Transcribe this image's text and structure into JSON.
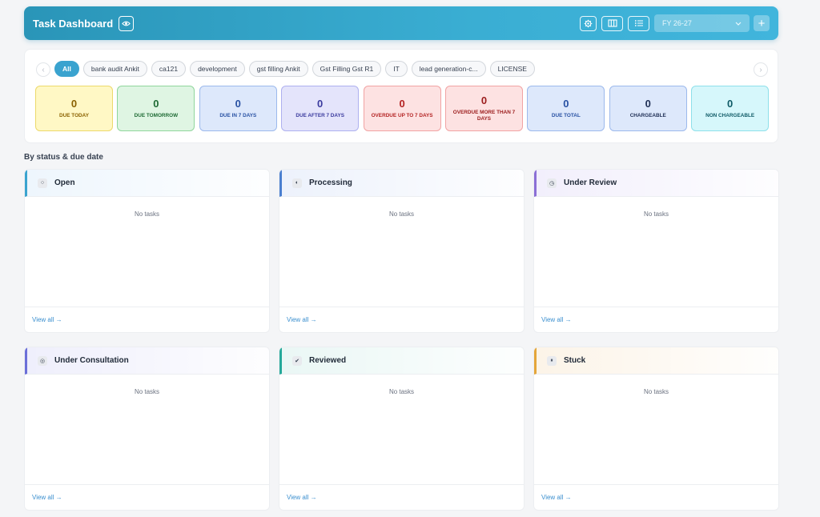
{
  "header": {
    "title": "Task Dashboard",
    "fy_value": "FY 26-27",
    "add_label": "+"
  },
  "filters": {
    "chips": [
      {
        "label": "All",
        "active": true
      },
      {
        "label": "bank audit Ankit"
      },
      {
        "label": "ca121"
      },
      {
        "label": "development"
      },
      {
        "label": "gst filling Ankit"
      },
      {
        "label": "Gst Filling Gst R1"
      },
      {
        "label": "IT"
      },
      {
        "label": "lead generation-c..."
      },
      {
        "label": "LICENSE"
      }
    ]
  },
  "stats": [
    {
      "value": "0",
      "label": "DUE TODAY",
      "bg": "#fff8c5",
      "border": "#ecd96b",
      "color": "#8a6100"
    },
    {
      "value": "0",
      "label": "DUE TOMORROW",
      "bg": "#dff5e3",
      "border": "#8fd69c",
      "color": "#1f6b35"
    },
    {
      "value": "0",
      "label": "DUE IN 7 DAYS",
      "bg": "#dde8fb",
      "border": "#9cb9ec",
      "color": "#2851a3"
    },
    {
      "value": "0",
      "label": "DUE AFTER 7 DAYS",
      "bg": "#e4e4fb",
      "border": "#aeb0ef",
      "color": "#3a3a9e"
    },
    {
      "value": "0",
      "label": "OVERDUE UP TO 7 DAYS",
      "bg": "#fde2e2",
      "border": "#f1a3a3",
      "color": "#b42323"
    },
    {
      "value": "0",
      "label": "OVERDUE MORE THAN 7 DAYS",
      "bg": "#fde2e2",
      "border": "#f1a3a3",
      "color": "#9b1c1c"
    },
    {
      "value": "0",
      "label": "DUE TOTAL",
      "bg": "#dde8fb",
      "border": "#9cb9ec",
      "color": "#2851a3"
    },
    {
      "value": "0",
      "label": "CHARGEABLE",
      "bg": "#dde8fb",
      "border": "#9cb9ec",
      "color": "#1f2f55"
    },
    {
      "value": "0",
      "label": "NON CHARGEABLE",
      "bg": "#d6f7fb",
      "border": "#8ee0ea",
      "color": "#0e5a66"
    }
  ],
  "section_title": "By status & due date",
  "columns": [
    {
      "title": "Open",
      "icon": "circle-icon",
      "glyph": "○",
      "accent": "#3aa3cf",
      "tint": "#eef6fd",
      "empty": "No tasks",
      "view_all": "View all →"
    },
    {
      "title": "Processing",
      "icon": "half-circle-icon",
      "glyph": "◐",
      "accent": "#4a7fd0",
      "tint": "#edf2fc",
      "empty": "No tasks",
      "view_all": "View all →"
    },
    {
      "title": "Under Review",
      "icon": "clock-icon",
      "glyph": "◷",
      "accent": "#8b6fd6",
      "tint": "#f2effc",
      "empty": "No tasks",
      "view_all": "View all →"
    },
    {
      "title": "Under Consultation",
      "icon": "record-icon",
      "glyph": "◎",
      "accent": "#6b6fd8",
      "tint": "#efeffc",
      "empty": "No tasks",
      "view_all": "View all →"
    },
    {
      "title": "Reviewed",
      "icon": "check-icon",
      "glyph": "✔",
      "accent": "#25a99a",
      "tint": "#eaf7f5",
      "empty": "No tasks",
      "view_all": "View all →"
    },
    {
      "title": "Stuck",
      "icon": "pause-icon",
      "glyph": "⏸",
      "accent": "#e4a63a",
      "tint": "#fcf4e8",
      "empty": "No tasks",
      "view_all": "View all →"
    }
  ]
}
